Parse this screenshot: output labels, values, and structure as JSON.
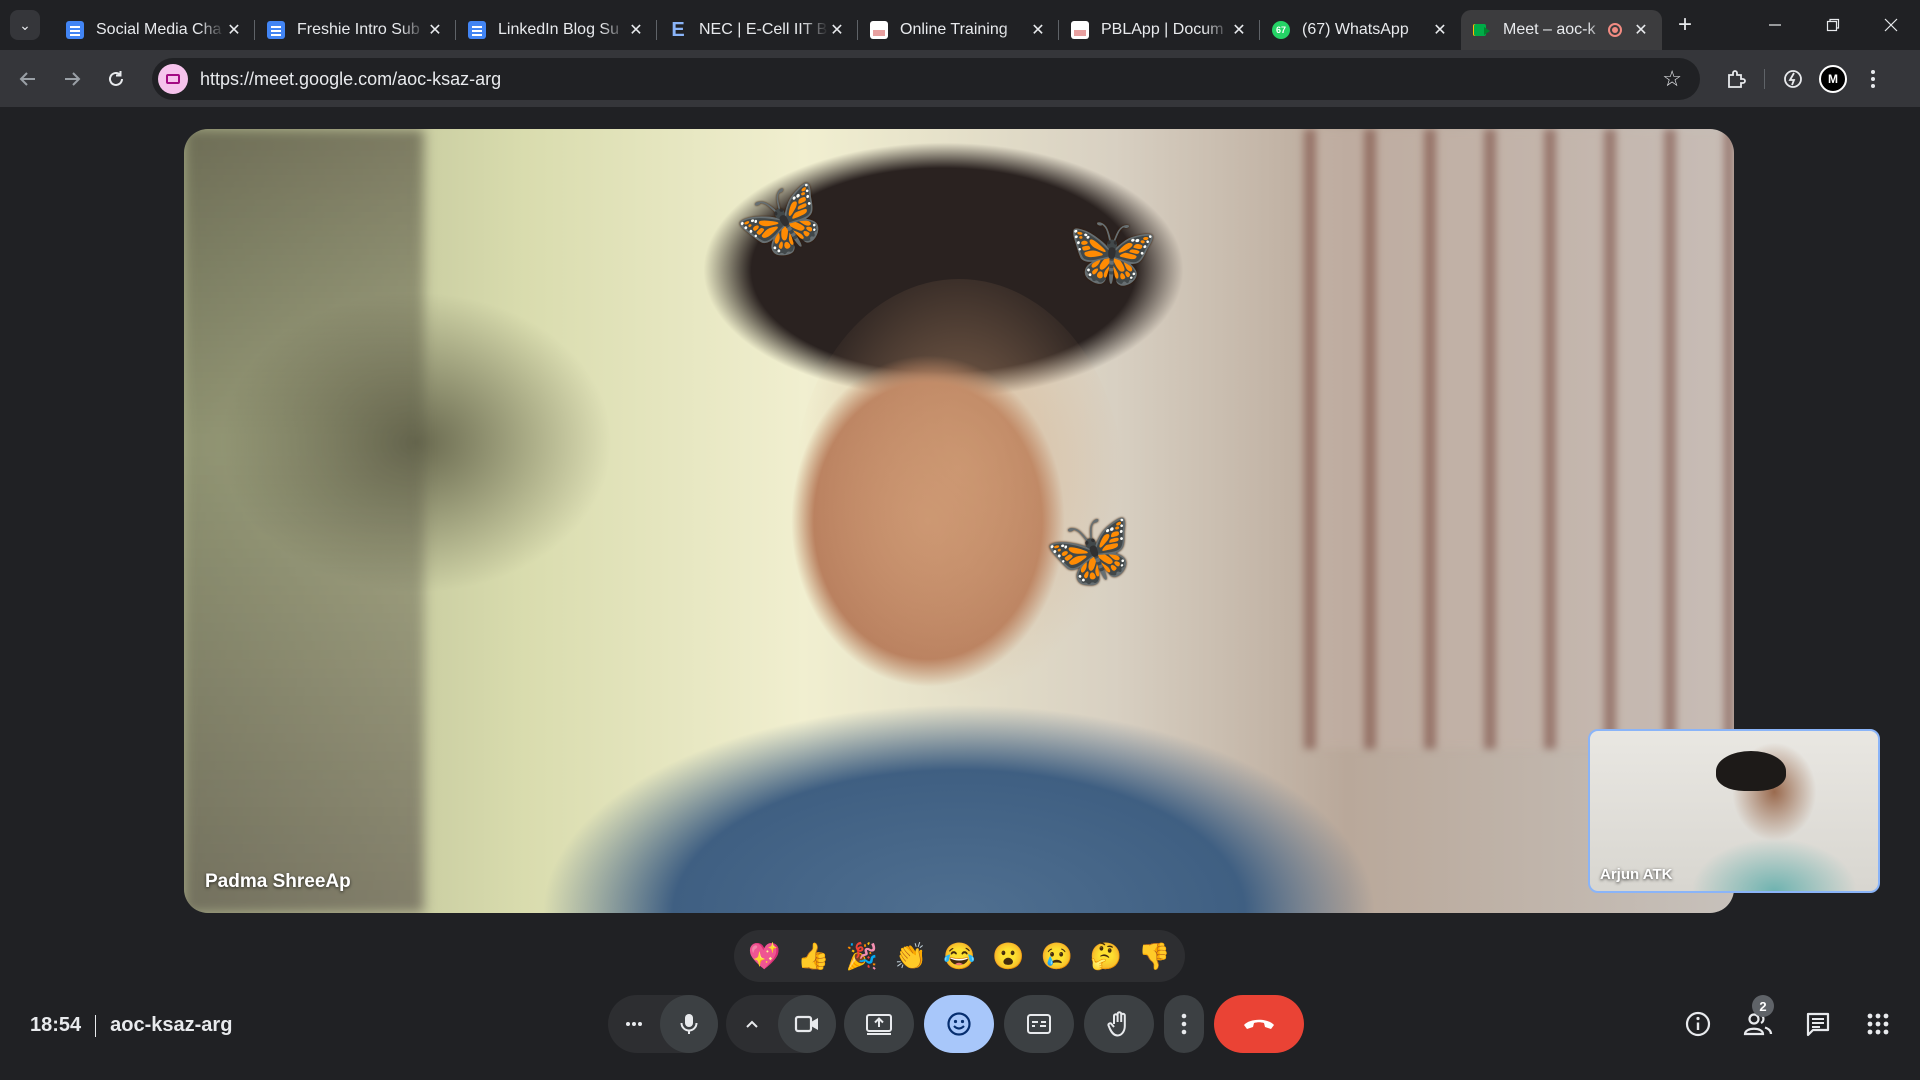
{
  "browser": {
    "tabs": [
      {
        "title": "Social Media Cha",
        "icon": "google-docs-icon"
      },
      {
        "title": "Freshie Intro Sub",
        "icon": "google-docs-icon"
      },
      {
        "title": "LinkedIn Blog Su",
        "icon": "google-docs-icon"
      },
      {
        "title": "NEC | E-Cell IIT B",
        "icon": "e-cell-icon"
      },
      {
        "title": "Online Training",
        "icon": "document-icon"
      },
      {
        "title": "PBLApp | Docum",
        "icon": "document-icon"
      },
      {
        "title": "(67) WhatsApp",
        "icon": "whatsapp-icon",
        "badge": "67"
      },
      {
        "title": "Meet – aoc-k",
        "icon": "google-meet-icon",
        "active": true,
        "recording": true
      }
    ],
    "url": "https://meet.google.com/aoc-ksaz-arg",
    "profile_initials": "M"
  },
  "meeting": {
    "main_participant": "Padma ShreeAp",
    "self_view_participant": "Arjun ATK",
    "time": "18:54",
    "code": "aoc-ksaz-arg",
    "participant_count": "2"
  },
  "reactions": [
    "💖",
    "👍",
    "🎉",
    "👏",
    "😂",
    "😮",
    "😢",
    "🤔",
    "👎"
  ],
  "colors": {
    "accent": "#a8c7fa",
    "end_call": "#ea4335",
    "surface": "#202124",
    "pip_border": "#8ab4f8"
  }
}
